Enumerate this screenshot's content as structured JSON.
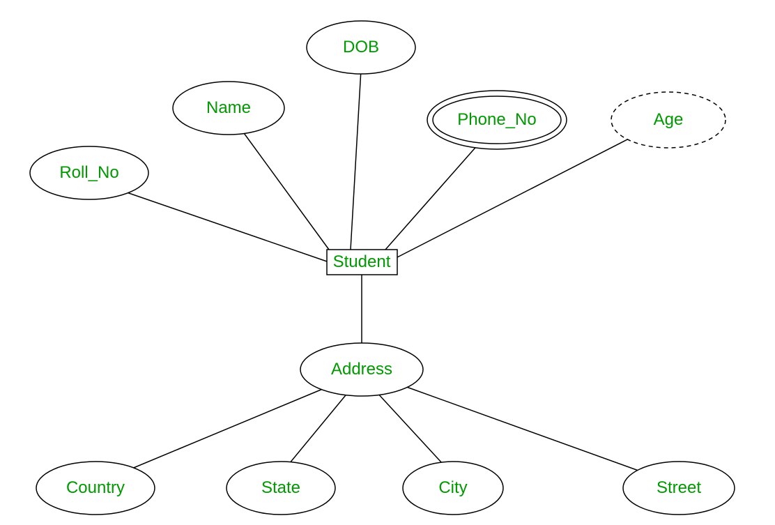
{
  "entity": {
    "label": "Student"
  },
  "attributes": {
    "roll_no": {
      "label": "Roll_No"
    },
    "name": {
      "label": "Name"
    },
    "dob": {
      "label": "DOB"
    },
    "phone_no": {
      "label": "Phone_No"
    },
    "age": {
      "label": "Age"
    },
    "address": {
      "label": "Address"
    }
  },
  "address_parts": {
    "country": {
      "label": "Country"
    },
    "state": {
      "label": "State"
    },
    "city": {
      "label": "City"
    },
    "street": {
      "label": "Street"
    }
  },
  "colors": {
    "text": "#009900",
    "stroke": "#000000",
    "background": "#ffffff"
  }
}
